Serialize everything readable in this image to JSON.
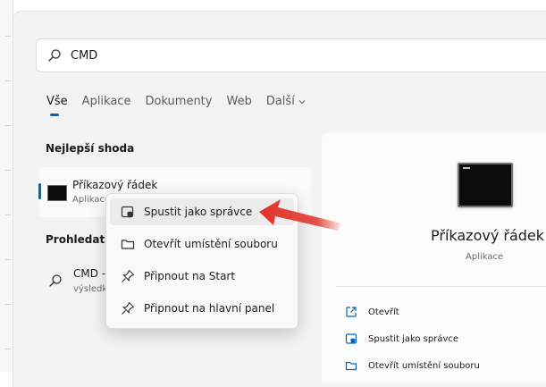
{
  "search": {
    "value": "CMD",
    "icon": "search-icon"
  },
  "tabs": [
    {
      "label": "Vše",
      "active": true
    },
    {
      "label": "Aplikace"
    },
    {
      "label": "Dokumenty"
    },
    {
      "label": "Web"
    },
    {
      "label": "Další"
    }
  ],
  "best_match": {
    "heading": "Nejlepší shoda",
    "title": "Příkazový řádek",
    "subtitle": "Aplikace"
  },
  "web_search": {
    "heading": "Prohledat p",
    "item_title": "CMD -",
    "item_sub": "výsledk"
  },
  "context_menu": [
    {
      "label": "Spustit jako správce",
      "icon": "shield-admin-icon",
      "highlighted": true
    },
    {
      "label": "Otevřít umístění souboru",
      "icon": "folder-icon"
    },
    {
      "label": "Připnout na Start",
      "icon": "pin-icon"
    },
    {
      "label": "Připnout na hlavní panel",
      "icon": "pin-icon"
    }
  ],
  "preview": {
    "title": "Příkazový řádek",
    "type": "Aplikace",
    "actions": [
      {
        "label": "Otevřít",
        "icon": "open-icon"
      },
      {
        "label": "Spustit jako správce",
        "icon": "shield-admin-icon"
      },
      {
        "label": "Otevřít umístění souboru",
        "icon": "folder-icon"
      }
    ]
  },
  "colors": {
    "accent": "#0067c0",
    "arrow": "#e0342a"
  }
}
